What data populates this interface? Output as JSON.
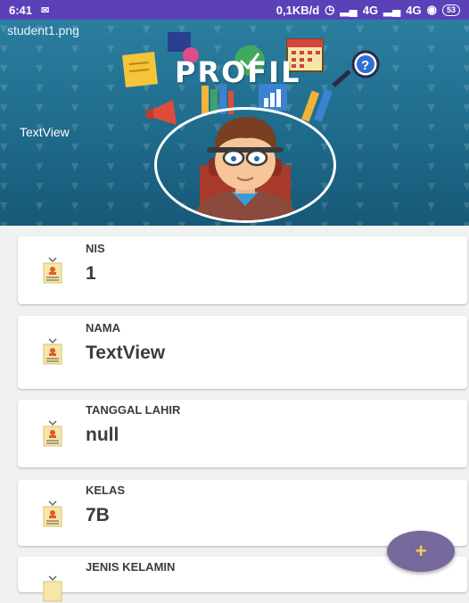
{
  "status_bar": {
    "time": "6:41",
    "message_icon": "message-icon",
    "network_info": "0,1KB/d",
    "signal_1": "4G",
    "signal_2": "4G",
    "battery": "53"
  },
  "header": {
    "filename": "student1.png",
    "title": "PROFIL",
    "textview": "TextView"
  },
  "fields": [
    {
      "label": "NIS",
      "value": "1"
    },
    {
      "label": "NAMA",
      "value": "TextView"
    },
    {
      "label": "TANGGAL LAHIR",
      "value": "null"
    },
    {
      "label": "KELAS",
      "value": "7B"
    },
    {
      "label": "JENIS KELAMIN",
      "value": ""
    }
  ],
  "fab": {
    "icon": "plus-icon",
    "symbol": "+"
  },
  "colors": {
    "status_bar": "#5b40b8",
    "header": "#1f6b8b",
    "card_text": "#3c3c3c",
    "fab": "#78699c"
  }
}
